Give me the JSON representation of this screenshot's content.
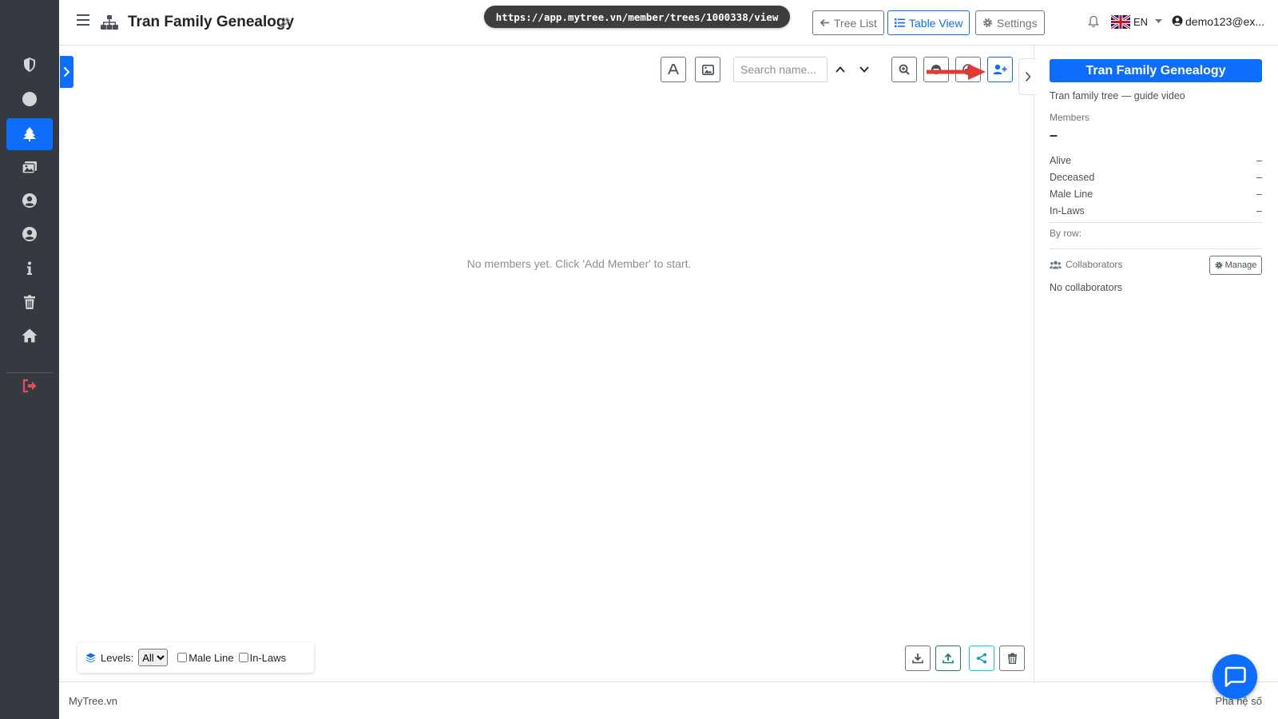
{
  "header": {
    "title": "Tran Family Genealogy",
    "url": "https://app.mytree.vn/member/trees/1000338/view",
    "tree_list_label": "Tree List",
    "table_view_label": "Table View",
    "settings_label": "Settings",
    "language": "EN",
    "user_email": "demo123@ex..."
  },
  "sidebar": {
    "items": [
      {
        "icon": "shield-icon"
      },
      {
        "icon": "circle-icon"
      },
      {
        "icon": "tree-icon",
        "active": true
      },
      {
        "icon": "images-icon"
      },
      {
        "icon": "user-circle-icon"
      },
      {
        "icon": "user-circle-icon"
      },
      {
        "icon": "info-icon"
      },
      {
        "icon": "trash-icon"
      },
      {
        "icon": "home-icon"
      },
      {
        "icon": "logout-icon"
      }
    ]
  },
  "toolbar": {
    "search_placeholder": "Search name..."
  },
  "canvas": {
    "empty_message": "No members yet. Click 'Add Member' to start."
  },
  "filters": {
    "levels_label": "Levels:",
    "levels_value": "All",
    "male_line_label": "Male Line",
    "in_laws_label": "In-Laws"
  },
  "panel": {
    "title": "Tran Family Genealogy",
    "subtitle": "Tran family tree — guide video",
    "members_label": "Members",
    "members_value": "–",
    "stats": [
      {
        "label": "Alive",
        "value": "–"
      },
      {
        "label": "Deceased",
        "value": "–"
      },
      {
        "label": "Male Line",
        "value": "–"
      },
      {
        "label": "In-Laws",
        "value": "–"
      }
    ],
    "by_row_label": "By row:",
    "collaborators_label": "Collaborators",
    "manage_label": "Manage",
    "no_collaborators": "No collaborators"
  },
  "footer": {
    "left": "MyTree.vn",
    "right": "Phả hệ số"
  },
  "colors": {
    "primary": "#0d6efd",
    "sidebar_bg": "#343a40",
    "success": "#198754",
    "info": "#0dcaf0",
    "annotation_arrow": "#e53935"
  }
}
